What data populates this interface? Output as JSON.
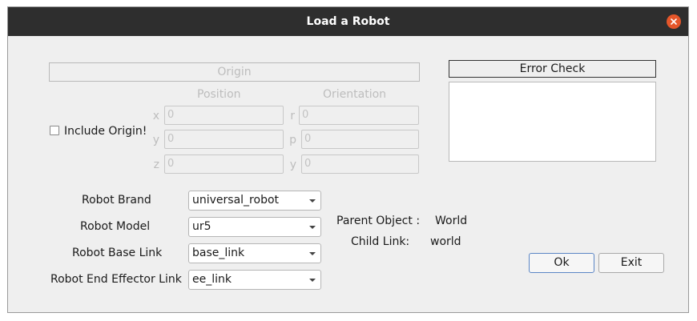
{
  "window": {
    "title": "Load a Robot"
  },
  "origin": {
    "header": "Origin",
    "position_label": "Position",
    "orientation_label": "Orientation",
    "include_label": "Include Origin!",
    "fields": [
      {
        "axis": "x",
        "value": "0"
      },
      {
        "axis": "y",
        "value": "0"
      },
      {
        "axis": "z",
        "value": "0"
      }
    ],
    "orient_fields": [
      {
        "axis": "r",
        "value": "0"
      },
      {
        "axis": "p",
        "value": "0"
      },
      {
        "axis": "y",
        "value": "0"
      }
    ]
  },
  "error_check": {
    "header": "Error Check",
    "content": ""
  },
  "robot": {
    "brand_label": "Robot Brand",
    "brand_value": "universal_robot",
    "model_label": "Robot Model",
    "model_value": "ur5",
    "base_label": "Robot Base Link",
    "base_value": "base_link",
    "ee_label": "Robot End Effector Link",
    "ee_value": "ee_link"
  },
  "parent": {
    "label": "Parent Object :",
    "value": "World"
  },
  "child": {
    "label": "Child Link:",
    "value": "world"
  },
  "buttons": {
    "ok": "Ok",
    "exit": "Exit"
  }
}
